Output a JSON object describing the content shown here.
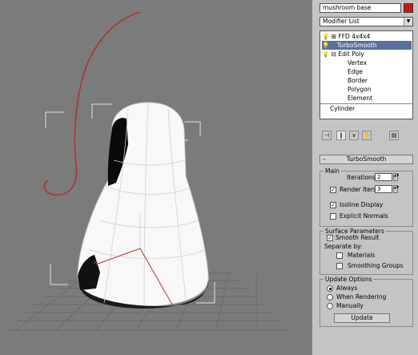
{
  "object_name": "mushroom base",
  "modifier_list_label": "Modifier List",
  "stack": [
    {
      "label": "FFD 4x4x4",
      "selected": false
    },
    {
      "label": "TurboSmooth",
      "selected": true
    },
    {
      "label": "Edit Poly",
      "selected": false
    },
    {
      "label": "Vertex",
      "selected": false
    },
    {
      "label": "Edge",
      "selected": false
    },
    {
      "label": "Border",
      "selected": false
    },
    {
      "label": "Polygon",
      "selected": false
    },
    {
      "label": "Element",
      "selected": false
    },
    {
      "label": "Cylinder",
      "selected": false
    }
  ],
  "rollout_title": "TurboSmooth",
  "main": {
    "title": "Main",
    "iterations_label": "Iterations:",
    "iterations_value": "2",
    "render_iters_label": "Render Iters:",
    "render_iters_value": "3",
    "render_iters_checked": true,
    "isoline_label": "Isoline Display",
    "isoline_checked": true,
    "explicit_normals_label": "Explicit Normals",
    "explicit_normals_checked": false
  },
  "surface": {
    "title": "Surface Parameters",
    "smooth_result_label": "Smooth Result",
    "smooth_result_checked": true,
    "separate_by_label": "Separate by:",
    "materials_label": "Materials",
    "materials_checked": false,
    "smoothing_groups_label": "Smoothing Groups",
    "smoothing_groups_checked": false
  },
  "update": {
    "title": "Update Options",
    "always_label": "Always",
    "when_rendering_label": "When Rendering",
    "manually_label": "Manually",
    "selected": "Always",
    "update_button_label": "Update"
  },
  "colors": {
    "object_color": "#c21818",
    "selected_stack": "#5a6fa0",
    "panel_bg": "#c4c4c4",
    "viewport_bg": "#7b7b7b"
  }
}
